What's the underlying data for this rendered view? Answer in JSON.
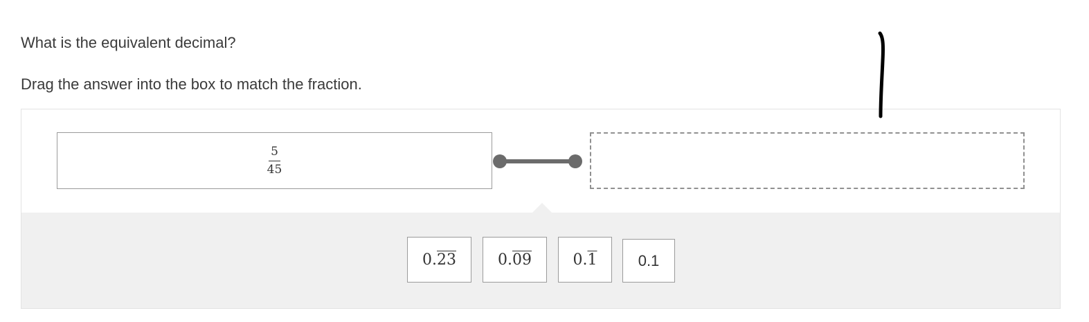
{
  "question": {
    "prompt": "What is the equivalent decimal?",
    "instruction": "Drag the answer into the box to match the fraction."
  },
  "match": {
    "fraction": {
      "numerator": "5",
      "denominator": "45"
    },
    "drop_target": {
      "value": ""
    }
  },
  "answer_tiles": [
    {
      "lead": "0.",
      "repeat": "23"
    },
    {
      "lead": "0.",
      "repeat": "09"
    },
    {
      "lead": "0.",
      "repeat": "1"
    },
    {
      "lead": "0.1",
      "repeat": ""
    }
  ],
  "colors": {
    "tray_background": "#f0f0f0",
    "connector": "#6b6b6b",
    "border": "#9a9a9a",
    "annotation_stroke": "#000000"
  }
}
